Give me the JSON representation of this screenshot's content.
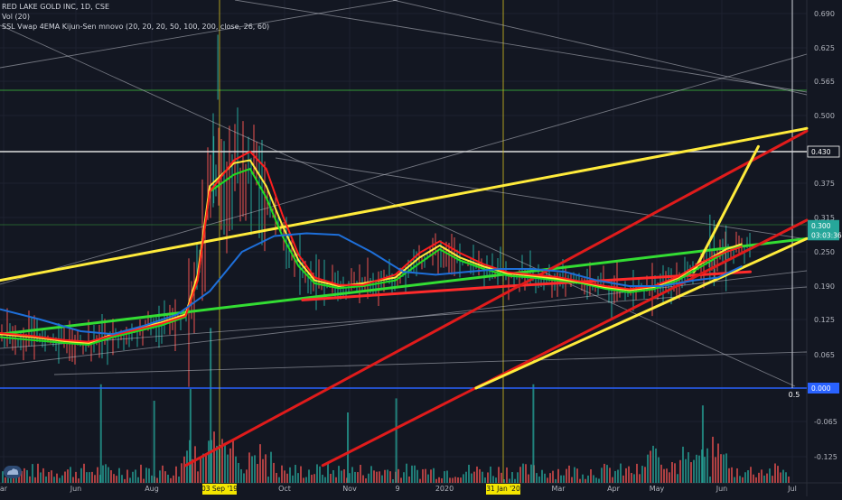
{
  "header": {
    "symbol_line": "RED LAKE GOLD INC, 1D, CSE",
    "vol_line": "Vol (20)",
    "indicator_line": "SSL Vwap 4EMA Kijun-Sen mnovo (20, 20, 20, 50, 100, 200, close, 26, 60)"
  },
  "chart_data": {
    "type": "line",
    "title": "RED LAKE GOLD INC, 1D, CSE",
    "xlabel": "",
    "ylabel": "",
    "x_ticks": [
      "ar",
      "Jun",
      "Aug",
      "Oct",
      "Nov",
      "9",
      "2020",
      "Mar",
      "Apr",
      "May",
      "Jun",
      "Jul"
    ],
    "x_highlight_labels": [
      "03 Sep '19",
      "31 Jan '20"
    ],
    "y_ticks": [
      "0.690",
      "0.625",
      "0.565",
      "0.500",
      "0.430",
      "0.375",
      "0.315",
      "0.250",
      "0.190",
      "0.125",
      "0.065",
      "0.000",
      "-0.065",
      "-0.125"
    ],
    "ylim": [
      -0.14,
      0.715
    ],
    "price_labels": [
      {
        "text": "0.430",
        "value": 0.43,
        "color": "#ffffff"
      },
      {
        "text": "0.300",
        "value": 0.3,
        "color": "#26a69a"
      },
      {
        "text": "03:03:36",
        "value": 0.282,
        "color": "#26a69a"
      },
      {
        "text": "0.000",
        "value": 0.0,
        "color": "#2962ff"
      }
    ],
    "fib_label": "0.5",
    "grid": true,
    "series": [
      {
        "values": [
          [
            0,
            0.095
          ],
          [
            0.04,
            0.09
          ],
          [
            0.08,
            0.085
          ],
          [
            0.11,
            0.082
          ],
          [
            0.14,
            0.095
          ],
          [
            0.17,
            0.105
          ],
          [
            0.2,
            0.115
          ],
          [
            0.23,
            0.13
          ],
          [
            0.245,
            0.2
          ],
          [
            0.26,
            0.36
          ],
          [
            0.29,
            0.39
          ],
          [
            0.31,
            0.4
          ],
          [
            0.33,
            0.35
          ],
          [
            0.35,
            0.28
          ],
          [
            0.37,
            0.225
          ],
          [
            0.39,
            0.195
          ],
          [
            0.42,
            0.186
          ],
          [
            0.45,
            0.19
          ],
          [
            0.49,
            0.2
          ],
          [
            0.52,
            0.23
          ],
          [
            0.545,
            0.255
          ],
          [
            0.57,
            0.235
          ],
          [
            0.6,
            0.22
          ],
          [
            0.63,
            0.208
          ],
          [
            0.66,
            0.205
          ],
          [
            0.69,
            0.2
          ],
          [
            0.72,
            0.195
          ],
          [
            0.75,
            0.185
          ],
          [
            0.78,
            0.178
          ],
          [
            0.81,
            0.184
          ],
          [
            0.84,
            0.2
          ],
          [
            0.87,
            0.225
          ],
          [
            0.9,
            0.25
          ],
          [
            0.92,
            0.26
          ]
        ],
        "color": "#22dd22"
      },
      {
        "values": [
          [
            0,
            0.1
          ],
          [
            0.04,
            0.095
          ],
          [
            0.08,
            0.088
          ],
          [
            0.11,
            0.085
          ],
          [
            0.14,
            0.1
          ],
          [
            0.17,
            0.11
          ],
          [
            0.2,
            0.12
          ],
          [
            0.23,
            0.135
          ],
          [
            0.245,
            0.21
          ],
          [
            0.26,
            0.37
          ],
          [
            0.29,
            0.41
          ],
          [
            0.31,
            0.415
          ],
          [
            0.33,
            0.37
          ],
          [
            0.35,
            0.3
          ],
          [
            0.37,
            0.235
          ],
          [
            0.39,
            0.2
          ],
          [
            0.42,
            0.19
          ],
          [
            0.45,
            0.195
          ],
          [
            0.49,
            0.205
          ],
          [
            0.52,
            0.24
          ],
          [
            0.545,
            0.262
          ],
          [
            0.57,
            0.24
          ],
          [
            0.6,
            0.224
          ],
          [
            0.63,
            0.212
          ],
          [
            0.66,
            0.208
          ],
          [
            0.69,
            0.203
          ],
          [
            0.72,
            0.197
          ],
          [
            0.75,
            0.188
          ],
          [
            0.78,
            0.182
          ],
          [
            0.81,
            0.188
          ],
          [
            0.84,
            0.204
          ],
          [
            0.87,
            0.23
          ],
          [
            0.9,
            0.255
          ],
          [
            0.92,
            0.265
          ]
        ],
        "color": "#ffeb3b"
      },
      {
        "values": [
          [
            0,
            0.102
          ],
          [
            0.04,
            0.097
          ],
          [
            0.08,
            0.09
          ],
          [
            0.11,
            0.087
          ],
          [
            0.14,
            0.098
          ],
          [
            0.17,
            0.108
          ],
          [
            0.2,
            0.118
          ],
          [
            0.23,
            0.132
          ],
          [
            0.245,
            0.2
          ],
          [
            0.26,
            0.36
          ],
          [
            0.29,
            0.415
          ],
          [
            0.31,
            0.43
          ],
          [
            0.33,
            0.4
          ],
          [
            0.35,
            0.32
          ],
          [
            0.37,
            0.245
          ],
          [
            0.39,
            0.205
          ],
          [
            0.42,
            0.192
          ],
          [
            0.45,
            0.192
          ],
          [
            0.49,
            0.21
          ],
          [
            0.52,
            0.248
          ],
          [
            0.545,
            0.27
          ],
          [
            0.57,
            0.248
          ],
          [
            0.6,
            0.228
          ],
          [
            0.63,
            0.214
          ],
          [
            0.66,
            0.21
          ],
          [
            0.69,
            0.206
          ],
          [
            0.72,
            0.198
          ],
          [
            0.75,
            0.19
          ],
          [
            0.78,
            0.184
          ],
          [
            0.81,
            0.19
          ],
          [
            0.84,
            0.206
          ],
          [
            0.87,
            0.232
          ],
          [
            0.9,
            0.25
          ],
          [
            0.92,
            0.26
          ]
        ],
        "color": "#ff1e1e"
      },
      {
        "values": [
          [
            0,
            0.145
          ],
          [
            0.05,
            0.125
          ],
          [
            0.1,
            0.105
          ],
          [
            0.14,
            0.1
          ],
          [
            0.18,
            0.115
          ],
          [
            0.22,
            0.135
          ],
          [
            0.26,
            0.18
          ],
          [
            0.3,
            0.25
          ],
          [
            0.34,
            0.28
          ],
          [
            0.38,
            0.285
          ],
          [
            0.42,
            0.282
          ],
          [
            0.46,
            0.25
          ],
          [
            0.5,
            0.215
          ],
          [
            0.54,
            0.21
          ],
          [
            0.58,
            0.215
          ],
          [
            0.62,
            0.22
          ],
          [
            0.66,
            0.22
          ],
          [
            0.7,
            0.215
          ],
          [
            0.74,
            0.2
          ],
          [
            0.78,
            0.19
          ],
          [
            0.82,
            0.19
          ],
          [
            0.86,
            0.2
          ],
          [
            0.89,
            0.205
          ],
          [
            0.92,
            0.225
          ]
        ],
        "color": "#1e6fd9"
      }
    ],
    "trend_lines": [
      {
        "points": [
          [
            0,
            0.1
          ],
          [
            1,
            0.275
          ]
        ],
        "color": "#33dd33"
      },
      {
        "points": [
          [
            0,
            0.2
          ],
          [
            1,
            0.475
          ]
        ],
        "color": "#ffeb3b"
      },
      {
        "points": [
          [
            0.375,
            0.163
          ],
          [
            0.63,
            0.19
          ],
          [
            0.93,
            0.215
          ]
        ],
        "color": "#ff2b2b"
      },
      {
        "points": [
          [
            0.23,
            -0.14
          ],
          [
            1,
            0.47
          ]
        ],
        "color": "#e01b1b"
      },
      {
        "points": [
          [
            0.4,
            -0.14
          ],
          [
            1,
            0.31
          ]
        ],
        "color": "#e01b1b"
      },
      {
        "points": [
          [
            0.59,
            0.0
          ],
          [
            1,
            0.275
          ]
        ],
        "color": "#ffeb3b"
      },
      {
        "points": [
          [
            0.86,
            0.215
          ],
          [
            0.94,
            0.44
          ]
        ],
        "color": "#ffeb3b"
      }
    ],
    "volume": {
      "colors": {
        "up": "#26a69a",
        "down": "#ef5350"
      },
      "spikes": [
        [
          0.124,
          0.42
        ],
        [
          0.19,
          0.35
        ],
        [
          0.235,
          0.4
        ],
        [
          0.26,
          0.66
        ],
        [
          0.43,
          0.3
        ],
        [
          0.49,
          0.36
        ],
        [
          0.66,
          0.42
        ],
        [
          0.87,
          0.33
        ]
      ]
    }
  }
}
